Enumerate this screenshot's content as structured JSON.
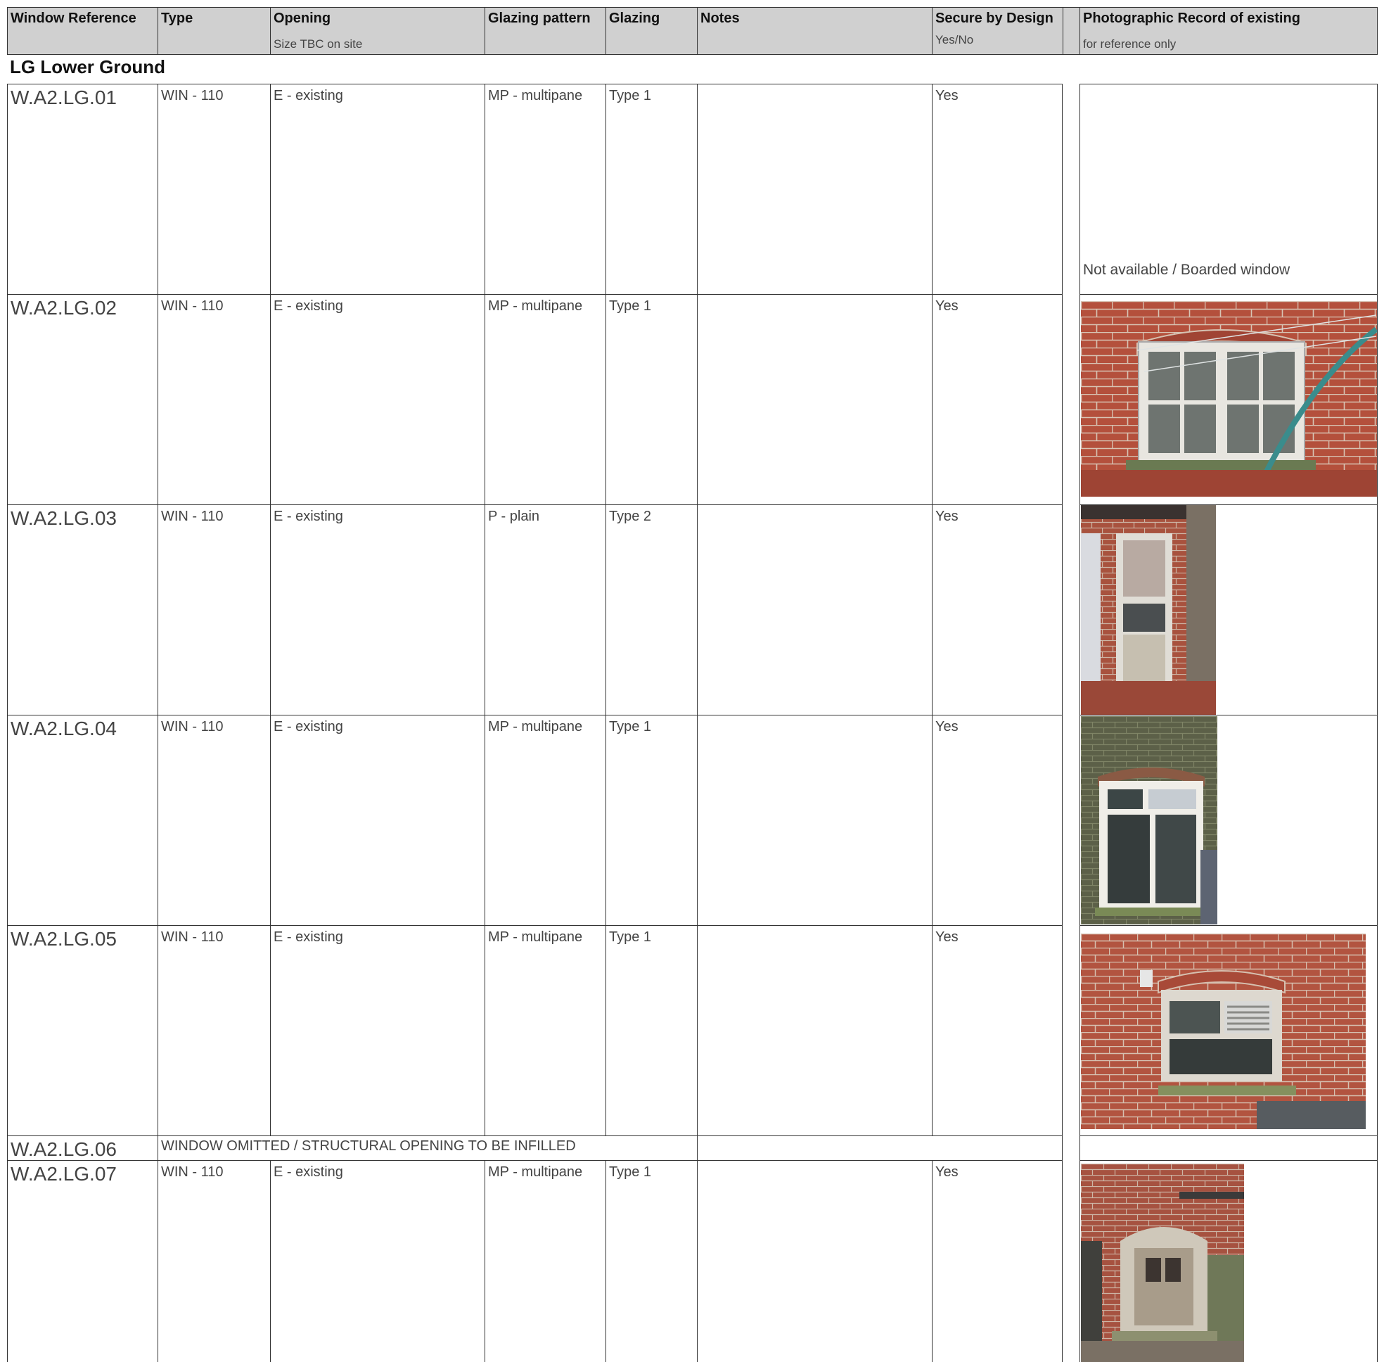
{
  "header": {
    "window_reference": "Window Reference",
    "type": "Type",
    "opening": "Opening",
    "opening_sub": "Size TBC on site",
    "glazing_pattern": "Glazing pattern",
    "glazing": "Glazing",
    "notes": "Notes",
    "secure_by_design": "Secure by Design",
    "secure_sub": "Yes/No",
    "photo_record": "Photographic Record of existing",
    "photo_sub": "for reference only"
  },
  "section_title": "LG Lower Ground",
  "rows": [
    {
      "ref": "W.A2.LG.01",
      "type": "WIN - 110",
      "opening": "E - existing",
      "pattern": "MP - multipane",
      "glazing": "Type 1",
      "notes": "",
      "secure": "Yes",
      "photo_note": "Not available / Boarded window",
      "photo": "none"
    },
    {
      "ref": "W.A2.LG.02",
      "type": "WIN - 110",
      "opening": "E - existing",
      "pattern": "MP - multipane",
      "glazing": "Type 1",
      "notes": "",
      "secure": "Yes",
      "photo": "brick-casement-window"
    },
    {
      "ref": "W.A2.LG.03",
      "type": "WIN - 110",
      "opening": "E - existing",
      "pattern": "P - plain",
      "glazing": "Type 2",
      "notes": "",
      "secure": "Yes",
      "photo": "narrow-boarded-window"
    },
    {
      "ref": "W.A2.LG.04",
      "type": "WIN - 110",
      "opening": "E - existing",
      "pattern": "MP - multipane",
      "glazing": "Type 1",
      "notes": "",
      "secure": "Yes",
      "photo": "mossy-brick-window"
    },
    {
      "ref": "W.A2.LG.05",
      "type": "WIN - 110",
      "opening": "E - existing",
      "pattern": "MP - multipane",
      "glazing": "Type 1",
      "notes": "",
      "secure": "Yes",
      "photo": "vented-brick-window"
    },
    {
      "ref": "W.A2.LG.06",
      "omitted_note": "WINDOW OMITTED  / STRUCTURAL OPENING TO BE INFILLED"
    },
    {
      "ref": "W.A2.LG.07",
      "type": "WIN - 110",
      "opening": "E - existing",
      "pattern": "MP - multipane",
      "glazing": "Type 1",
      "notes": "",
      "secure": "Yes",
      "photo": "arched-brick-window"
    }
  ]
}
